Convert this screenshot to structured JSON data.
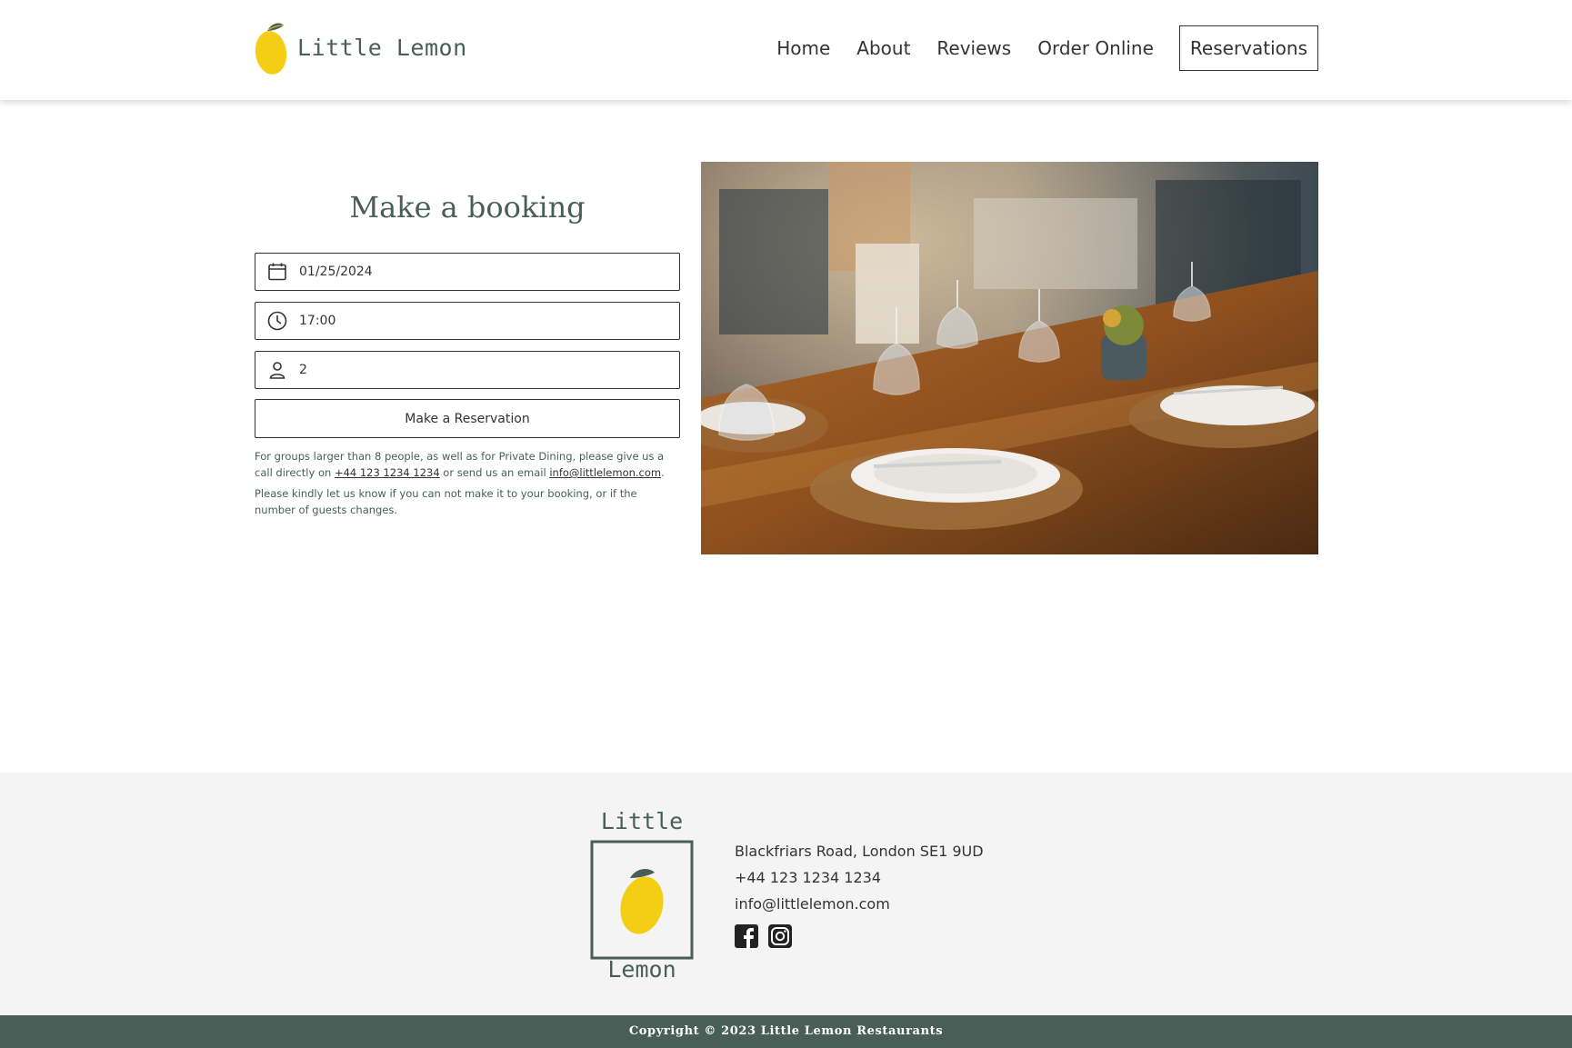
{
  "brand": {
    "name": "Little Lemon"
  },
  "nav": {
    "items": [
      {
        "label": "Home"
      },
      {
        "label": "About"
      },
      {
        "label": "Reviews"
      },
      {
        "label": "Order Online"
      },
      {
        "label": "Reservations"
      }
    ]
  },
  "booking": {
    "title": "Make a booking",
    "date_value": "01/25/2024",
    "time_value": "17:00",
    "guests_value": "2",
    "submit_label": "Make a Reservation",
    "note1_pre": "For groups larger than 8 people, as well as for Private Dining, please give us a call directly on ",
    "note1_phone": "+44 123 1234 1234",
    "note1_mid": " or send us an email ",
    "note1_email": "info@littlelemon.com",
    "note1_end": ".",
    "note2": "Please kindly let us know if you can not make it to your booking, or if the number of guests changes."
  },
  "footer": {
    "logo_top": "Little",
    "logo_bottom": "Lemon",
    "address": "Blackfriars Road, London SE1 9UD",
    "phone": "+44 123 1234 1234",
    "email": "info@littlelemon.com",
    "social_icons": [
      "facebook-icon",
      "instagram-icon"
    ]
  },
  "copyright": "Copyright © 2023 Little Lemon Restaurants",
  "colors": {
    "primary_green": "#495e57",
    "lemon_yellow": "#f4ce14",
    "footer_bg": "#f4f4f4"
  }
}
